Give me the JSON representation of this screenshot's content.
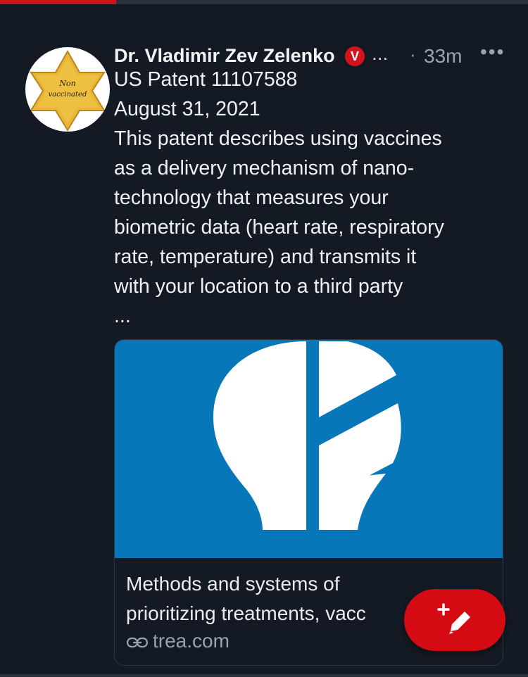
{
  "progress": {
    "fraction": 0.22,
    "color": "#c8161d"
  },
  "post": {
    "author_name": "Dr. Vladimir Zev Zelenko",
    "verified_badge": "V",
    "name_overflow": "...",
    "separator": "·",
    "timestamp": "33m",
    "options_icon": "•••",
    "avatar_badge_text_line1": "Non",
    "avatar_badge_text_line2": "vaccinated",
    "lines": [
      "US Patent 11107588",
      "August 31, 2021",
      "This patent describes using vaccines",
      "as a delivery mechanism of nano-",
      "technology that measures your",
      "biometric data (heart rate, respiratory",
      "rate, temperature) and transmits it",
      "with your location to a third party",
      "..."
    ]
  },
  "link_card": {
    "title_line1": "Methods and systems of",
    "title_line2": "prioritizing treatments, vacc",
    "domain": "trea.com",
    "image_icon": "lightbulb-logo-icon",
    "image_bg": "#0877b9"
  },
  "fab": {
    "icon": "compose-icon",
    "color": "#d50b13"
  },
  "colors": {
    "background": "#141a23",
    "accent": "#d3141c"
  }
}
